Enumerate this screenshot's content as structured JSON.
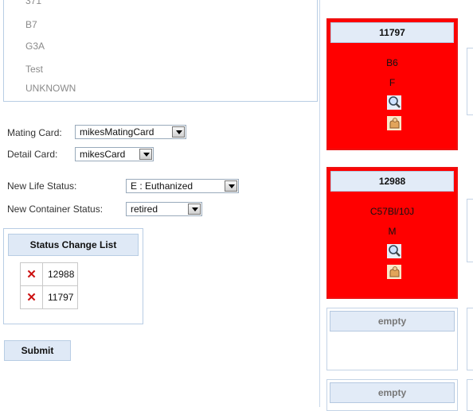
{
  "strain_list": [
    "371",
    "B7",
    "G3A",
    "Test",
    "UNKNOWN"
  ],
  "form": {
    "mating_card_label": "Mating Card:",
    "mating_card_value": "mikesMatingCard",
    "detail_card_label": "Detail Card:",
    "detail_card_value": "mikesCard",
    "life_status_label": "New Life Status:",
    "life_status_value": "E : Euthanized",
    "container_status_label": "New Container Status:",
    "container_status_value": "retired"
  },
  "status_change_list": {
    "title": "Status Change List",
    "remove_glyph": "✕",
    "items": [
      "12988",
      "11797"
    ]
  },
  "submit_label": "Submit",
  "cards": [
    {
      "id": "11797",
      "strain": "B6",
      "sex": "F",
      "state": "selected"
    },
    {
      "id": "12988",
      "strain": "C57Bl/10J",
      "sex": "M",
      "state": "selected"
    },
    {
      "id": "empty",
      "state": "empty"
    },
    {
      "id": "empty",
      "state": "empty"
    }
  ],
  "colors": {
    "selected_card": "#ff0000",
    "header_bg": "#e2ebf7",
    "border": "#b8cde4",
    "remove_x": "#cc1111"
  },
  "icons": [
    "magnifier-icon",
    "hand-icon",
    "close-icon",
    "dropdown-arrow-icon"
  ]
}
